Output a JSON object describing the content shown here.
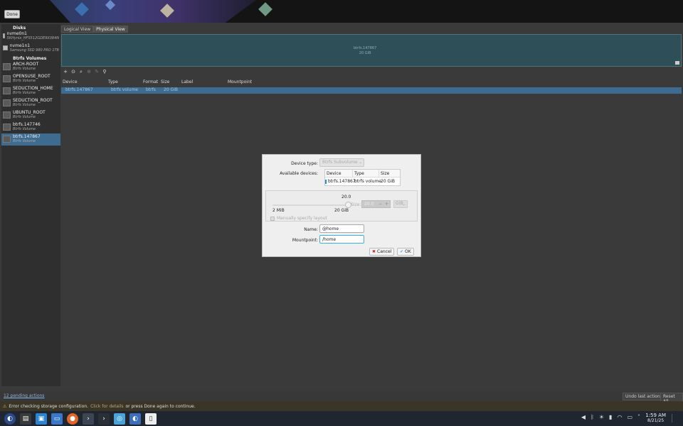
{
  "top": {
    "done_label": "Done"
  },
  "sidebar": {
    "disks_header": "Disks",
    "disks": [
      {
        "name": "nvme0n1",
        "desc": "SKHynix_HFS512GDE9X084N"
      },
      {
        "name": "nvme1n1",
        "desc": "Samsung SSD 980 PRO 1TB"
      }
    ],
    "btrfs_header": "Btrfs Volumes",
    "volumes": [
      {
        "name": "ARCH-ROOT",
        "desc": "Btrfs Volume"
      },
      {
        "name": "OPENSUSE_ROOT",
        "desc": "Btrfs Volume"
      },
      {
        "name": "SEDUCTION_HOME",
        "desc": "Btrfs Volume"
      },
      {
        "name": "SEDUCTION_ROOT",
        "desc": "Btrfs Volume"
      },
      {
        "name": "UBUNTU_ROOT",
        "desc": "Btrfs Volume"
      },
      {
        "name": "btrfs.147746",
        "desc": "Btrfs Volume"
      },
      {
        "name": "btrfs.147867",
        "desc": "Btrfs Volume"
      }
    ]
  },
  "tabs": {
    "logical": "Logical View",
    "physical": "Physical View"
  },
  "device_map": {
    "name": "btrfs.147867",
    "size": "20 GiB"
  },
  "toolbar": {
    "add": "+",
    "config": "⊙",
    "search": "⌕",
    "lock": "⊕",
    "edit": "✎",
    "pin": "⚲"
  },
  "table": {
    "headers": [
      "Device",
      "Type",
      "Format",
      "Size",
      "Label",
      "Mountpoint"
    ],
    "row": {
      "device": "btrfs.147867",
      "type": "btrfs volume",
      "format": "btrfs",
      "size": "20 GiB",
      "label": "",
      "mountpoint": ""
    }
  },
  "bottom": {
    "pending": "12 pending actions",
    "undo": "Undo last action",
    "reset": "Reset All"
  },
  "error": {
    "text1": "Error checking storage configuration.",
    "link": "Click for details",
    "text2": "or press Done again to continue."
  },
  "dialog": {
    "device_type_label": "Device type:",
    "device_type_value": "Btrfs Subvolume",
    "available_label": "Available devices:",
    "dev_headers": [
      "Device",
      "Type",
      "Size"
    ],
    "dev_row": {
      "device": "btrfs.147867",
      "type": "btrfs volume",
      "size": "20 GiB"
    },
    "slider_value": "20.0",
    "slider_fraction": 1.0,
    "slider_min": "2 MiB",
    "slider_max": "20 GiB",
    "size_label": "Size:",
    "size_value": "20.0",
    "unit": "GiB",
    "manual_label": "Manually specify layout",
    "name_label": "Name:",
    "name_value": "@home",
    "mountpoint_label": "Mountpoint:",
    "mountpoint_value": "/home",
    "cancel": "Cancel",
    "ok": "OK"
  },
  "taskbar": {
    "time": "1:59 AM",
    "date": "8/21/25"
  }
}
